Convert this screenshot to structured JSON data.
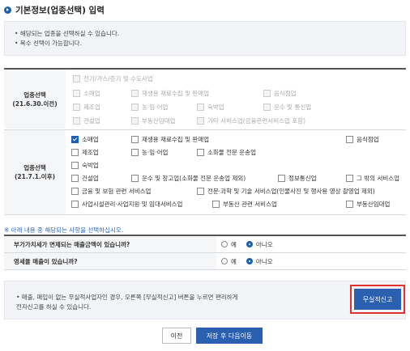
{
  "header": {
    "title": "기본정보(업종선택) 입력"
  },
  "notice": {
    "lines": [
      "• 해당되는 업종을 선택하실 수 있습니다.",
      "• 복수 선택이 가능합니다."
    ]
  },
  "old_section": {
    "label_line1": "업종선택",
    "label_line2": "(21.6.30.이전)",
    "items": [
      "전기/가스/증기 및 수도사업",
      "소매업",
      "재생용 재료수집 및 판매업",
      "음식점업",
      "제조업",
      "농·임·어업",
      "숙박업",
      "운수 및 통신업",
      "건설업",
      "부동산임대업",
      "기타 서비스업(금융관련서비스업 포함)"
    ]
  },
  "new_section": {
    "label_line1": "업종선택",
    "label_line2": "(21.7.1.이후)",
    "items": [
      "소매업",
      "재생용 재료수집 및 판매업",
      "음식점업",
      "제조업",
      "농·임·어업",
      "소화물 전문 운송업",
      "숙박업",
      "건설업",
      "운수 및 창고업(소화물 전문 운송업 제외)",
      "정보통신업",
      "그 밖의 서비스업",
      "금융 및 보험 관련 서비스업",
      "전문·과학 및 기술 서비스업(인물사진 및 행사용 영상 촬영업 제외)",
      "사업시설관리·사업지원 및 임대서비스업",
      "부동산 관련 서비스업",
      "부동산임대업"
    ],
    "checked": "소매업"
  },
  "hint": "※ 아래 내용 중 해당되는 사항을 선택하십시오.",
  "questions": [
    {
      "text": "부가가치세가 면제되는 매출금액이 있습니까?",
      "yes": "예",
      "no": "아니오",
      "selected": "아니오"
    },
    {
      "text": "영세율 매출이 있습니까?",
      "yes": "예",
      "no": "아니오",
      "selected": "아니오"
    }
  ],
  "bottom": {
    "line1": "• 매출, 매입이 없는 무실적사업자인 경우, 오른쪽 [무실적신고] 버튼을 누르면 편리하게",
    "line2": "  전자신고를 하실 수 있습니다.",
    "button": "무실적신고"
  },
  "actions": {
    "prev": "이전",
    "next": "저장 후 다음이동"
  },
  "colors": {
    "accent": "#2b5fb0",
    "highlight": "#e03030"
  }
}
